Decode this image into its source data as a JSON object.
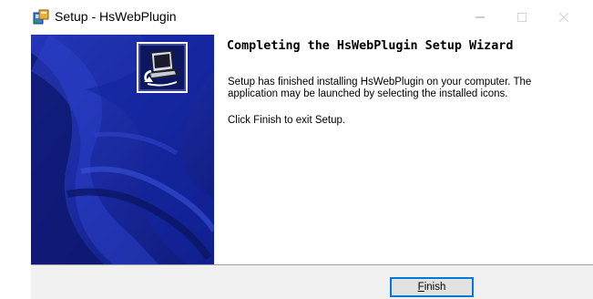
{
  "window": {
    "title": "Setup - HsWebPlugin"
  },
  "controls": {
    "minimize_icon": "minimize-icon",
    "maximize_icon": "maximize-icon",
    "close_icon": "close-icon"
  },
  "content": {
    "heading": "Completing the HsWebPlugin Setup Wizard",
    "paragraph1": "Setup has finished installing HsWebPlugin on your computer. The application may be launched by selecting the installed icons.",
    "paragraph2": "Click Finish to exit Setup."
  },
  "footer": {
    "finish_label_first": "F",
    "finish_label_rest": "inish"
  },
  "colors": {
    "sidebar_blue": "#1b2ea3",
    "sidebar_dark": "#0c1468",
    "footer_bg": "#f0f0f0",
    "button_border": "#0078d7"
  }
}
